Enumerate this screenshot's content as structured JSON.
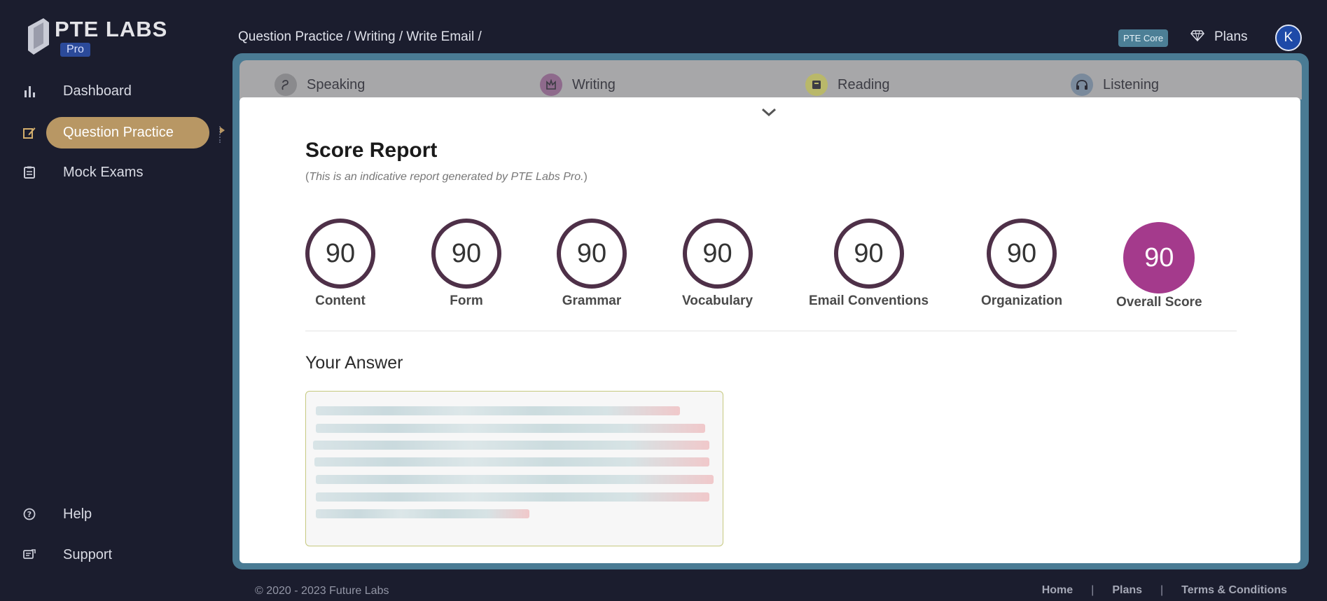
{
  "brand": {
    "title": "PTE LABS",
    "badge": "Pro"
  },
  "sidebar": {
    "items": [
      {
        "label": "Dashboard",
        "icon": "bar-chart-icon"
      },
      {
        "label": "Question Practice",
        "icon": "edit-icon",
        "active": true
      },
      {
        "label": "Mock Exams",
        "icon": "clipboard-icon"
      }
    ],
    "bottom_items": [
      {
        "label": "Help",
        "icon": "help-icon"
      },
      {
        "label": "Support",
        "icon": "support-icon"
      }
    ]
  },
  "header": {
    "breadcrumb": "Question Practice / Writing / Write Email /",
    "product_badge": "PTE Core",
    "plans_label": "Plans",
    "avatar_initial": "K"
  },
  "tabs": [
    {
      "label": "Speaking",
      "icon": "speaking-icon",
      "color": "#8a8a8d"
    },
    {
      "label": "Writing",
      "icon": "writing-icon",
      "color": "#8e6a8c"
    },
    {
      "label": "Reading",
      "icon": "reading-icon",
      "color": "#b9b86a"
    },
    {
      "label": "Listening",
      "icon": "listening-icon",
      "color": "#7a8a9c"
    }
  ],
  "report": {
    "title": "Score Report",
    "subtitle_open": "(",
    "subtitle": "This is an indicative report generated by PTE Labs Pro.",
    "subtitle_close": ")",
    "scores": [
      {
        "label": "Content",
        "value": "90"
      },
      {
        "label": "Form",
        "value": "90"
      },
      {
        "label": "Grammar",
        "value": "90"
      },
      {
        "label": "Vocabulary",
        "value": "90"
      },
      {
        "label": "Email Conventions",
        "value": "90"
      },
      {
        "label": "Organization",
        "value": "90"
      },
      {
        "label": "Overall Score",
        "value": "90"
      }
    ],
    "answer_title": "Your Answer"
  },
  "colors": {
    "accent": "#b89764",
    "ring": "#4e3048",
    "overall": "#a43a8c",
    "frame": "#4a7b94"
  },
  "footer": {
    "copyright": "© 2020 - 2023 Future Labs",
    "links": [
      "Home",
      "Plans",
      "Terms & Conditions"
    ],
    "separator": "|"
  }
}
